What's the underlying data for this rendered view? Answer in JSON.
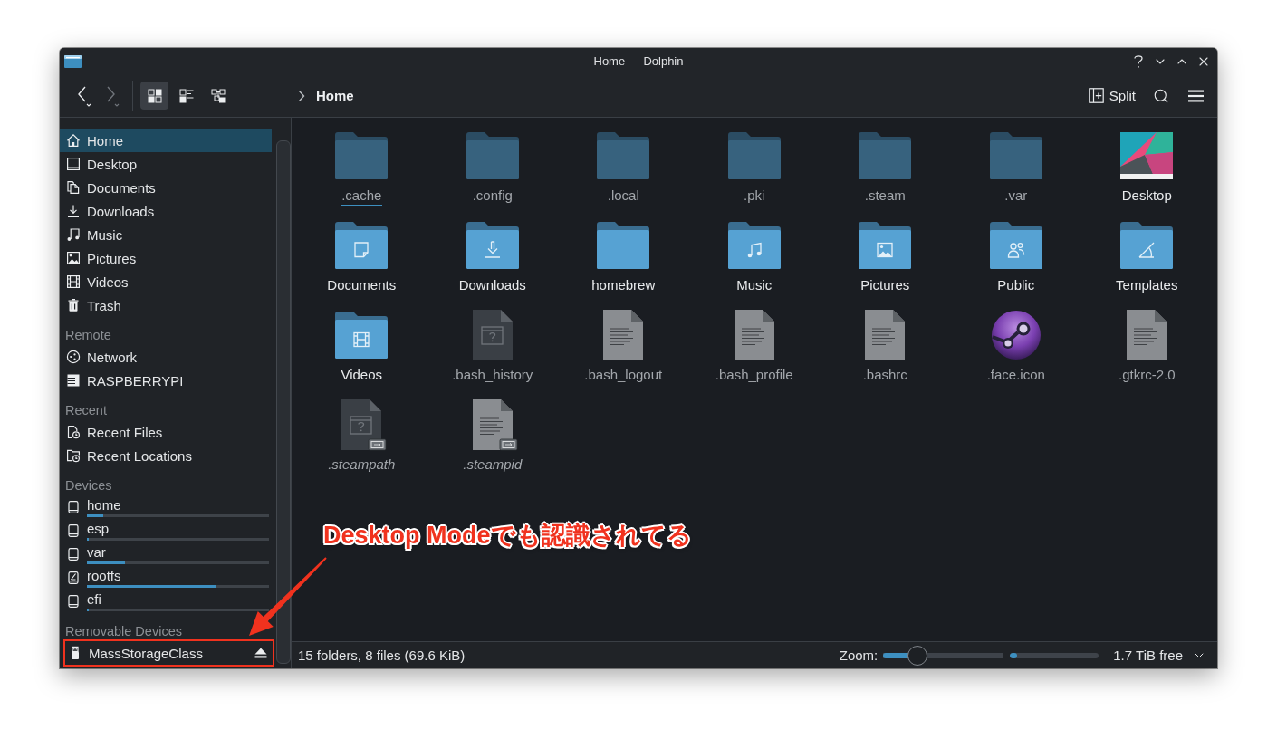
{
  "window": {
    "title": "Home — Dolphin"
  },
  "toolbar": {
    "back": {
      "disabled": false
    },
    "forward": {
      "disabled": true
    },
    "view_modes": [
      {
        "kind": "icons",
        "selected": true
      },
      {
        "kind": "compact",
        "selected": false
      },
      {
        "kind": "details",
        "selected": false
      }
    ],
    "breadcrumb": [
      "Home"
    ],
    "split_label": "Split"
  },
  "sidebar": {
    "sections": [
      {
        "items": [
          {
            "label": "Home",
            "kind": "home",
            "selected": true
          },
          {
            "label": "Desktop",
            "kind": "desktop",
            "selected": false
          },
          {
            "label": "Documents",
            "kind": "documents",
            "selected": false
          },
          {
            "label": "Downloads",
            "kind": "downloads",
            "selected": false
          },
          {
            "label": "Music",
            "kind": "music",
            "selected": false
          },
          {
            "label": "Pictures",
            "kind": "pictures",
            "selected": false
          },
          {
            "label": "Videos",
            "kind": "videos",
            "selected": false
          },
          {
            "label": "Trash",
            "kind": "trash",
            "selected": false
          }
        ]
      },
      {
        "heading": "Remote",
        "items": [
          {
            "label": "Network",
            "kind": "network",
            "selected": false
          },
          {
            "label": "RASPBERRYPI",
            "kind": "server",
            "selected": false
          }
        ]
      },
      {
        "heading": "Recent",
        "items": [
          {
            "label": "Recent Files",
            "kind": "recentfile",
            "selected": false
          },
          {
            "label": "Recent Locations",
            "kind": "recentfolder",
            "selected": false
          }
        ]
      },
      {
        "heading": "Devices",
        "items": [
          {
            "label": "home",
            "kind": "disk",
            "selected": false,
            "level": 0.09
          },
          {
            "label": "esp",
            "kind": "disk",
            "selected": false,
            "level": 0.01
          },
          {
            "label": "var",
            "kind": "disk",
            "selected": false,
            "level": 0.21
          },
          {
            "label": "rootfs",
            "kind": "system",
            "selected": false,
            "level": 0.71
          },
          {
            "label": "efi",
            "kind": "disk",
            "selected": false,
            "level": 0.01
          }
        ]
      },
      {
        "heading": "Removable Devices",
        "items": [
          {
            "label": "MassStorageClass",
            "kind": "usb",
            "selected": false,
            "highlighted": true
          }
        ]
      }
    ]
  },
  "files": [
    {
      "name": ".cache",
      "kind": "folder",
      "hidden": true,
      "symlink": false,
      "focused": true
    },
    {
      "name": ".config",
      "kind": "folder",
      "hidden": true,
      "symlink": false,
      "focused": false
    },
    {
      "name": ".local",
      "kind": "folder",
      "hidden": true,
      "symlink": false,
      "focused": false
    },
    {
      "name": ".pki",
      "kind": "folder",
      "hidden": true,
      "symlink": false,
      "focused": false
    },
    {
      "name": ".steam",
      "kind": "folder",
      "hidden": true,
      "symlink": false,
      "focused": false
    },
    {
      "name": ".var",
      "kind": "folder",
      "hidden": true,
      "symlink": false,
      "focused": false
    },
    {
      "name": "Desktop",
      "kind": "desktop",
      "hidden": false,
      "symlink": false,
      "focused": false
    },
    {
      "name": "Documents",
      "kind": "documents",
      "hidden": false,
      "symlink": false,
      "focused": false
    },
    {
      "name": "Downloads",
      "kind": "downloads",
      "hidden": false,
      "symlink": false,
      "focused": false
    },
    {
      "name": "homebrew",
      "kind": "folder",
      "hidden": false,
      "symlink": false,
      "focused": false
    },
    {
      "name": "Music",
      "kind": "music",
      "hidden": false,
      "symlink": false,
      "focused": false
    },
    {
      "name": "Pictures",
      "kind": "pictures",
      "hidden": false,
      "symlink": false,
      "focused": false
    },
    {
      "name": "Public",
      "kind": "public",
      "hidden": false,
      "symlink": false,
      "focused": false
    },
    {
      "name": "Templates",
      "kind": "templates",
      "hidden": false,
      "symlink": false,
      "focused": false
    },
    {
      "name": "Videos",
      "kind": "videos",
      "hidden": false,
      "symlink": false,
      "focused": false
    },
    {
      "name": ".bash_history",
      "kind": "unknown",
      "hidden": true,
      "symlink": false,
      "focused": false
    },
    {
      "name": ".bash_logout",
      "kind": "text",
      "hidden": true,
      "symlink": false,
      "focused": false
    },
    {
      "name": ".bash_profile",
      "kind": "text",
      "hidden": true,
      "symlink": false,
      "focused": false
    },
    {
      "name": ".bashrc",
      "kind": "text",
      "hidden": true,
      "symlink": false,
      "focused": false
    },
    {
      "name": ".face.icon",
      "kind": "image",
      "hidden": true,
      "symlink": false,
      "focused": false
    },
    {
      "name": ".gtkrc-2.0",
      "kind": "text",
      "hidden": true,
      "symlink": false,
      "focused": false
    },
    {
      "name": ".steampath",
      "kind": "unknown",
      "hidden": true,
      "symlink": true,
      "focused": false
    },
    {
      "name": ".steampid",
      "kind": "text",
      "hidden": true,
      "symlink": true,
      "focused": false
    }
  ],
  "status_bar": {
    "summary": "15 folders, 8 files (69.6 KiB)",
    "zoom_label": "Zoom:",
    "zoom": {
      "level": 0.28
    },
    "disk": {
      "level": 0.08
    },
    "free": "1.7 TiB free"
  },
  "annotation": {
    "text": "Desktop Modeでも認識されてる"
  }
}
